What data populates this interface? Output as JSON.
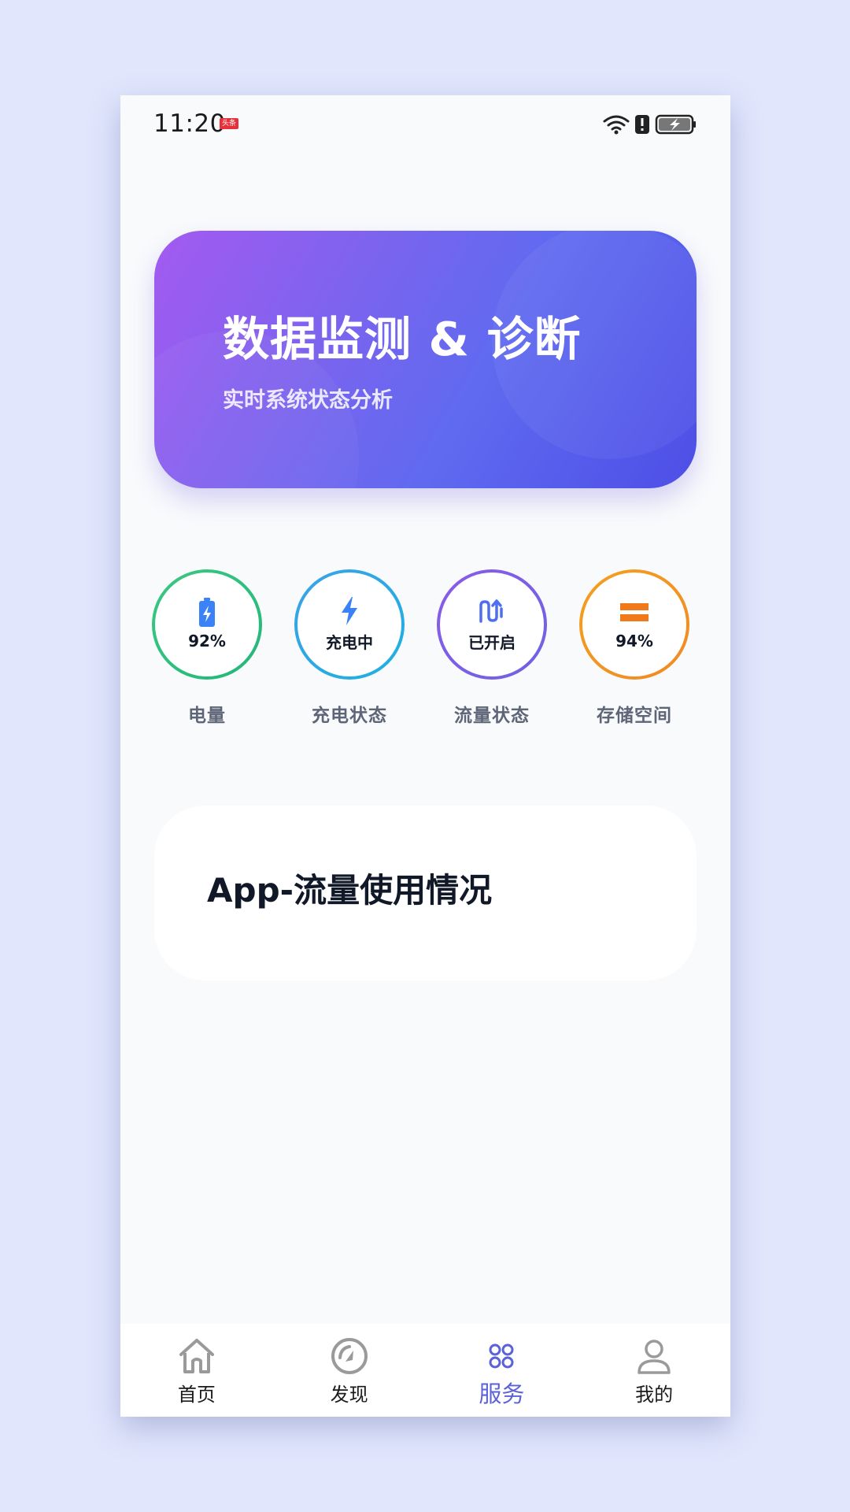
{
  "status_bar": {
    "time": "11:20",
    "news_badge": "头条"
  },
  "hero": {
    "title": "数据监测 & 诊断",
    "subtitle": "实时系统状态分析"
  },
  "metrics": [
    {
      "value": "92%",
      "label": "电量",
      "icon": "battery-charging-icon",
      "color": "#2bbf7d"
    },
    {
      "value": "充电中",
      "label": "充电状态",
      "icon": "lightning-icon",
      "color": "#2a9fe3"
    },
    {
      "value": "已开启",
      "label": "流量状态",
      "icon": "data-transfer-icon",
      "color": "#7b5de6"
    },
    {
      "value": "94%",
      "label": "存储空间",
      "icon": "storage-icon",
      "color": "#f29524"
    }
  ],
  "traffic_card": {
    "title": "App-流量使用情况"
  },
  "bottom_nav": {
    "items": [
      {
        "label": "首页",
        "icon": "home-icon",
        "active": false
      },
      {
        "label": "发现",
        "icon": "discover-icon",
        "active": false
      },
      {
        "label": "服务",
        "icon": "services-icon",
        "active": true
      },
      {
        "label": "我的",
        "icon": "profile-icon",
        "active": false
      }
    ]
  },
  "colors": {
    "accent": "#5b62d8",
    "background": "#f8fafc",
    "outer_background": "#e1e6fd"
  }
}
